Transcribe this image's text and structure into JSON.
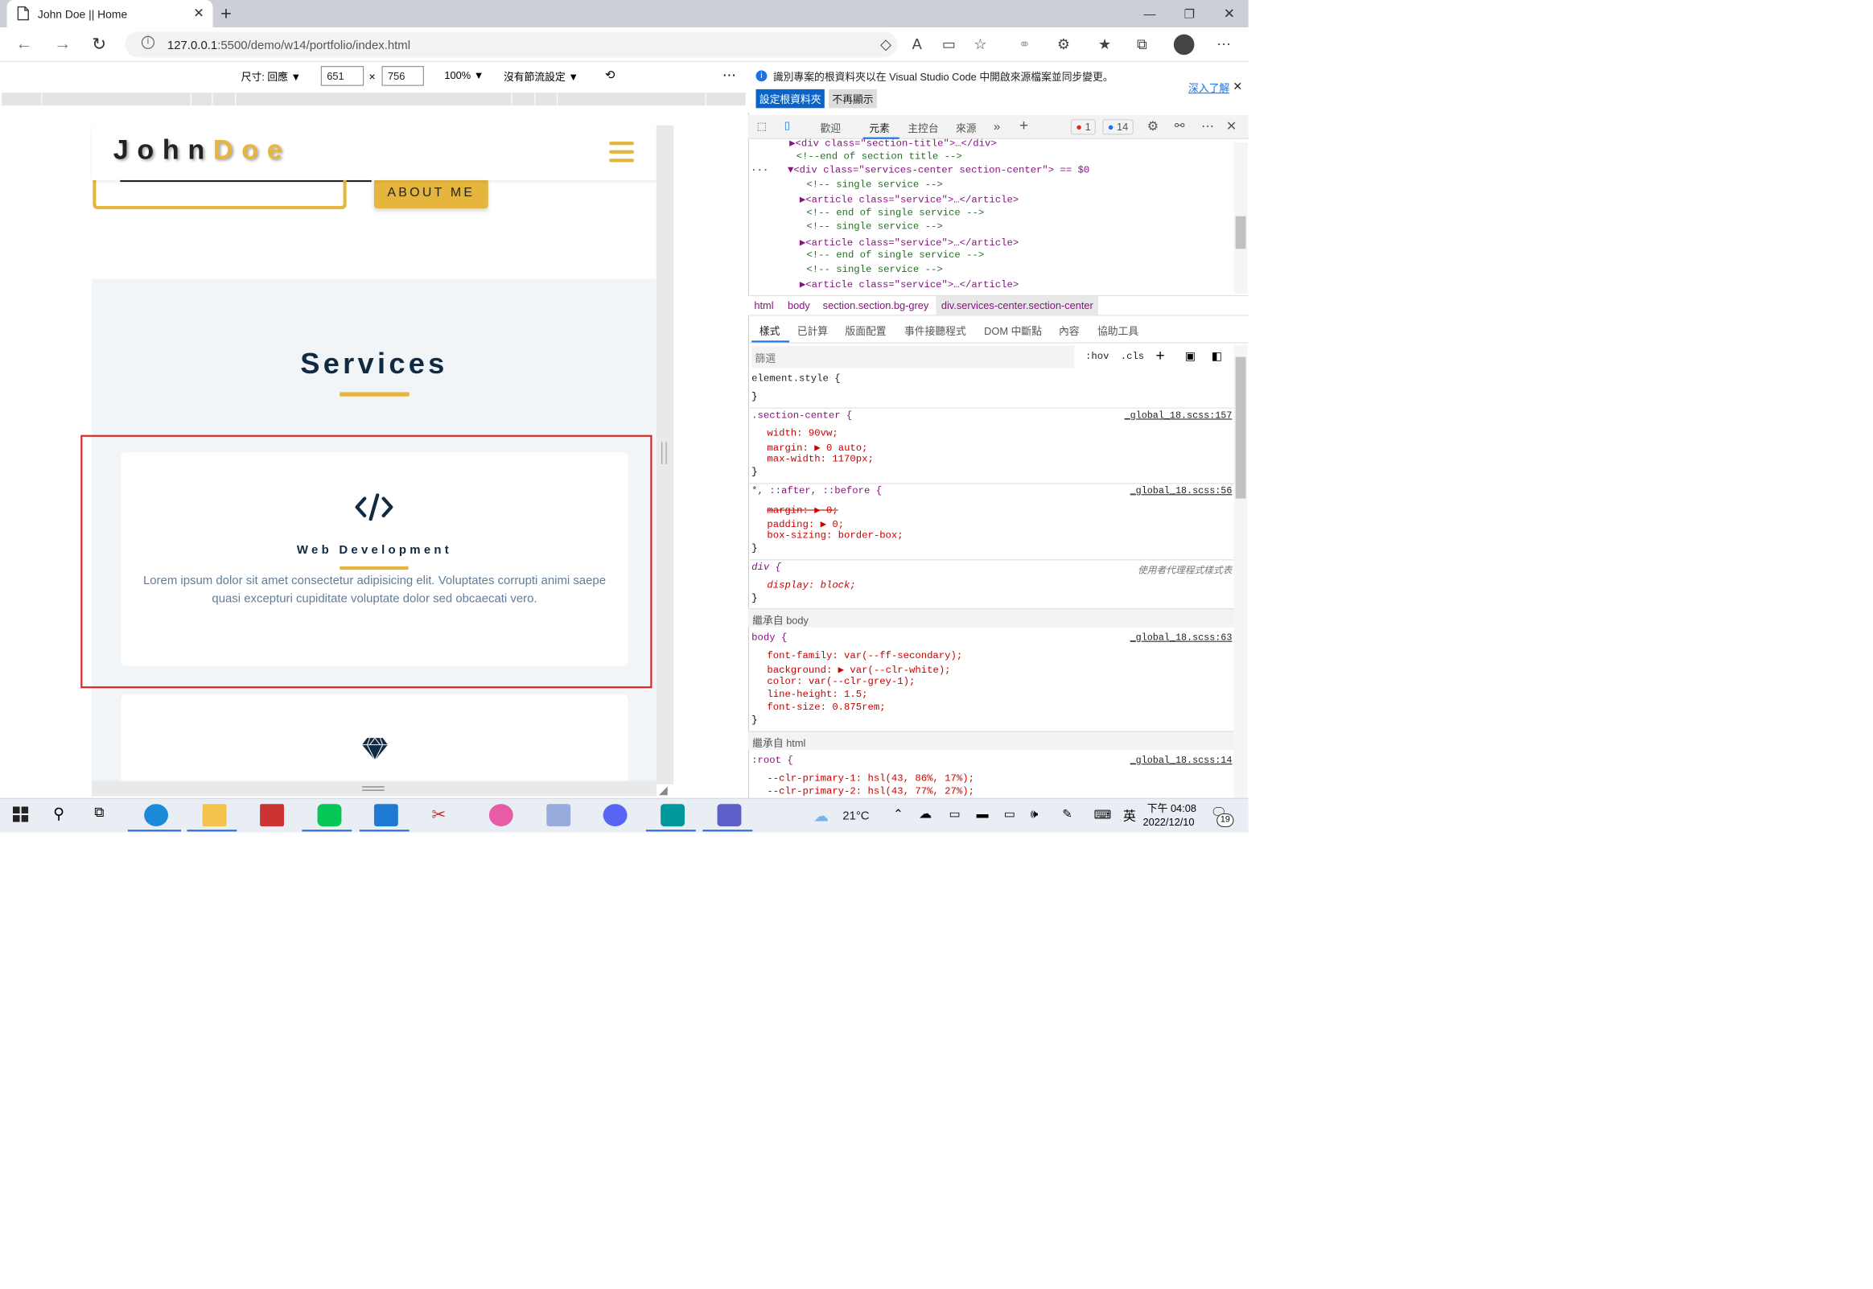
{
  "browser": {
    "tab_title": "John Doe || Home",
    "url_host": "127.0.0.1",
    "url_path": ":5500/demo/w14/portfolio/index.html"
  },
  "device_toolbar": {
    "dimensions_label": "尺寸: 回應",
    "width": "651",
    "height": "756",
    "times": "×",
    "zoom": "100%",
    "throttle": "沒有節流設定"
  },
  "page": {
    "logo_first": "John",
    "logo_last": "Doe",
    "about_button": "ABOUT ME",
    "section_title": "Services",
    "card": {
      "title": "Web Development",
      "text": "Lorem ipsum dolor sit amet consectetur adipisicing elit. Voluptates corrupti animi saepe quasi excepturi cupiditate voluptate dolor sed obcaecati vero."
    }
  },
  "devtools": {
    "info_text": "識別專案的根資料夾以在 Visual Studio Code 中開啟來源檔案並同步變更。",
    "learn_more": "深入了解",
    "set_root": "設定根資料夾",
    "dont_show": "不再顯示",
    "tabs": [
      "歡迎",
      "元素",
      "主控台",
      "來源"
    ],
    "error_count": "1",
    "issue_count": "14",
    "dom_lines": [
      "▶<div class=\"section-title\">…</div>",
      "<!--end of section title -->",
      "▼<div class=\"services-center section-center\"> == $0",
      "<!-- single service -->",
      "▶<article class=\"service\">…</article>",
      "<!-- end of single service -->",
      "<!-- single service -->",
      "▶<article class=\"service\">…</article>",
      "<!-- end of single service -->",
      "<!-- single service -->",
      "▶<article class=\"service\">…</article>"
    ],
    "breadcrumbs": [
      "html",
      "body",
      "section.section.bg-grey",
      "div.services-center.section-center"
    ],
    "subtabs": [
      "樣式",
      "已計算",
      "版面配置",
      "事件接聽程式",
      "DOM 中斷點",
      "內容",
      "協助工具"
    ],
    "filter_placeholder": "篩選",
    "hov": ":hov",
    "cls": ".cls",
    "element_style": "element.style {",
    "close_brace": "}",
    "rule1_sel": ".section-center {",
    "rule1_src": "_global_18.scss:157",
    "rule1_props": [
      "width: 90vw;",
      "margin: ▶ 0 auto;",
      "max-width: 1170px;"
    ],
    "rule2_sel": "*, ::after, ::before {",
    "rule2_src": "_global_18.scss:56",
    "rule2_props": [
      "margin: ▶ 0;",
      "padding: ▶ 0;",
      "box-sizing: border-box;"
    ],
    "rule3_sel": "div {",
    "rule3_src": "使用者代理程式樣式表",
    "rule3_props": [
      "display: block;"
    ],
    "inherit_body": "繼承自 body",
    "rule4_sel": "body {",
    "rule4_src": "_global_18.scss:63",
    "rule4_props": [
      "font-family: var(--ff-secondary);",
      "background: ▶ var(--clr-white);",
      "color: var(--clr-grey-1);",
      "line-height: 1.5;",
      "font-size: 0.875rem;"
    ],
    "inherit_html": "繼承自 html",
    "rule5_sel": ":root {",
    "rule5_src": "_global_18.scss:14",
    "rule5_props": [
      "--clr-primary-1: hsl(43, 86%, 17%);",
      "--clr-primary-2: hsl(43, 77%, 27%);"
    ]
  },
  "taskbar": {
    "weather": "21°C",
    "ime": "英",
    "time": "下午 04:08",
    "date": "2022/12/10",
    "notif_count": "19"
  },
  "colors": {
    "accent": "#e5b53e",
    "heading": "#102a42",
    "body_text": "#617d98",
    "bg_grey": "#f1f5f8",
    "highlight": "#e02020"
  }
}
